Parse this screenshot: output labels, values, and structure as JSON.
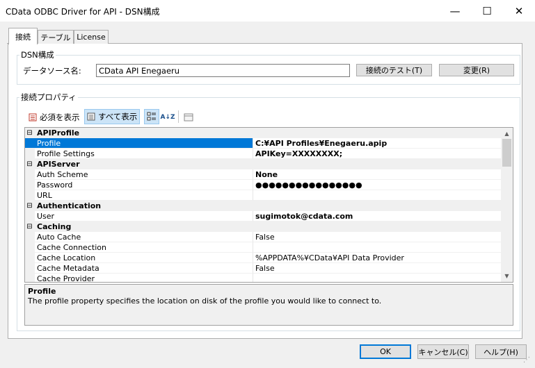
{
  "window": {
    "title": "CData ODBC Driver for API - DSN構成",
    "minimize_glyph": "—",
    "maximize_glyph": "☐",
    "close_glyph": "✕"
  },
  "tabs": [
    {
      "label": "接続",
      "active": true
    },
    {
      "label": "テーブル",
      "active": false
    },
    {
      "label": "License",
      "active": false
    }
  ],
  "dsn_group": {
    "label": "DSN構成",
    "field_label": "データソース名:",
    "field_value": "CData API Enegaeru",
    "test_button": "接続のテスト(T)",
    "change_button": "変更(R)"
  },
  "properties_group": {
    "label": "接続プロパティ",
    "toolbar": {
      "required_label": "必須を表示",
      "all_label": "すべて表示",
      "sort_glyph": "A↓Z"
    }
  },
  "property_grid": [
    {
      "type": "category",
      "name": "APIProfile"
    },
    {
      "type": "property",
      "name": "Profile",
      "value": "C:¥API Profiles¥Enegaeru.apip",
      "bold": true,
      "selected": true
    },
    {
      "type": "property",
      "name": "Profile Settings",
      "value": "APIKey=XXXXXXXX;",
      "bold": true
    },
    {
      "type": "category",
      "name": "APIServer"
    },
    {
      "type": "property",
      "name": "Auth Scheme",
      "value": "None",
      "bold": true
    },
    {
      "type": "property",
      "name": "Password",
      "value": "●●●●●●●●●●●●●●●●",
      "bold": true
    },
    {
      "type": "property",
      "name": "URL",
      "value": ""
    },
    {
      "type": "category",
      "name": "Authentication"
    },
    {
      "type": "property",
      "name": "User",
      "value": "sugimotok@cdata.com",
      "bold": true
    },
    {
      "type": "category",
      "name": "Caching"
    },
    {
      "type": "property",
      "name": "Auto Cache",
      "value": "False"
    },
    {
      "type": "property",
      "name": "Cache Connection",
      "value": ""
    },
    {
      "type": "property",
      "name": "Cache Location",
      "value": "%APPDATA%¥CData¥API Data Provider"
    },
    {
      "type": "property",
      "name": "Cache Metadata",
      "value": "False"
    },
    {
      "type": "property",
      "name": "Cache Provider",
      "value": ""
    }
  ],
  "description": {
    "title": "Profile",
    "text": "The profile property specifies the location on disk of the profile you would like to connect to."
  },
  "footer": {
    "ok": "OK",
    "cancel": "キャンセル(C)",
    "help": "ヘルプ(H)"
  },
  "colors": {
    "selection": "#0078d7",
    "window_bg": "#f0f0f0"
  }
}
